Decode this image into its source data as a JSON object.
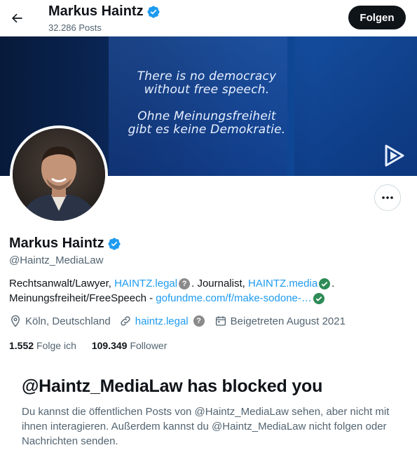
{
  "header": {
    "name": "Markus Haintz",
    "posts": "32.286 Posts",
    "follow_label": "Folgen"
  },
  "banner": {
    "quote_en_1": "There is no democracy",
    "quote_en_2": "without free speech.",
    "quote_de_1": "Ohne Meinungsfreiheit",
    "quote_de_2": "gibt es keine Demokratie."
  },
  "profile": {
    "name": "Markus Haintz",
    "handle": "@Haintz_MediaLaw",
    "bio": {
      "line1_a": "Rechtsanwalt/Lawyer,",
      "line1_link1": "HAINTZ.legal",
      "line1_b": ". Journalist,",
      "line1_link2": "HAINTZ.media",
      "line1_c": ".",
      "line2_a": "Meinungsfreiheit/FreeSpeech -",
      "line2_link": "gofundme.com/f/make-sodone-…"
    },
    "location": "Köln, Deutschland",
    "website": "haintz.legal",
    "joined": "Beigetreten August 2021",
    "following_count": "1.552",
    "following_label": "Folge ich",
    "followers_count": "109.349",
    "followers_label": "Follower"
  },
  "blocked": {
    "title": "@Haintz_MediaLaw has blocked you",
    "text": "Du kannst die öffentlichen Posts von @Haintz_MediaLaw sehen, aber nicht mit ihnen interagieren. Außerdem kannst du @Haintz_MediaLaw nicht folgen oder Nachrichten senden."
  },
  "colors": {
    "accent": "#1d9bf0",
    "verified": "#1d9bf0",
    "muted": "#536471",
    "green_check": "#2e8b57"
  },
  "icons": [
    "back-arrow-icon",
    "verified-badge-icon",
    "more-icon",
    "location-icon",
    "link-icon",
    "calendar-icon",
    "play-logo-icon",
    "info-icon",
    "checkmark-icon"
  ]
}
